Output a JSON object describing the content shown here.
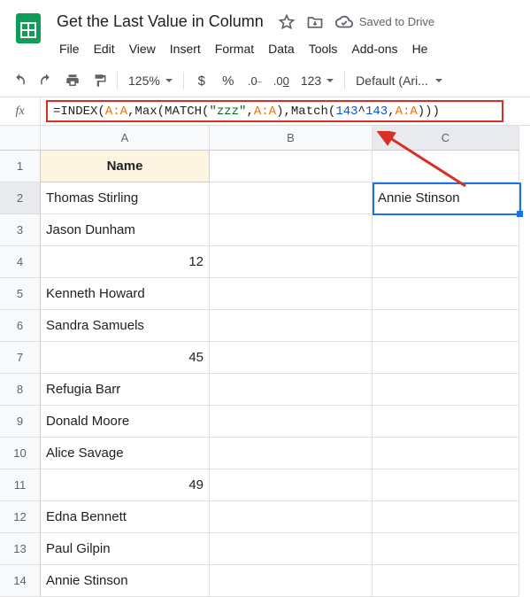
{
  "header": {
    "doc_title": "Get the Last Value in Column",
    "saved_label": "Saved to Drive",
    "menu": [
      "File",
      "Edit",
      "View",
      "Insert",
      "Format",
      "Data",
      "Tools",
      "Add-ons",
      "He"
    ]
  },
  "toolbar": {
    "zoom": "125%",
    "font": "Default (Ari..."
  },
  "formula": {
    "tokens": [
      {
        "t": "=INDEX(",
        "c": "f-black"
      },
      {
        "t": "A:A",
        "c": "f-orange"
      },
      {
        "t": ",Max(MATCH(",
        "c": "f-black"
      },
      {
        "t": "\"zzz\"",
        "c": "f-green"
      },
      {
        "t": ",",
        "c": "f-black"
      },
      {
        "t": "A:A",
        "c": "f-orange"
      },
      {
        "t": "),Match(",
        "c": "f-black"
      },
      {
        "t": "143",
        "c": "f-blue"
      },
      {
        "t": "^",
        "c": "f-black"
      },
      {
        "t": "143",
        "c": "f-blue"
      },
      {
        "t": ",",
        "c": "f-black"
      },
      {
        "t": "A:A",
        "c": "f-orange"
      },
      {
        "t": ")))",
        "c": "f-black"
      }
    ]
  },
  "grid": {
    "columns": [
      "A",
      "B",
      "C"
    ],
    "rows": [
      {
        "n": "1",
        "A": "Name",
        "A_header": true
      },
      {
        "n": "2",
        "A": "Thomas Stirling",
        "C": "Annie Stinson",
        "C_selected": true
      },
      {
        "n": "3",
        "A": "Jason Dunham"
      },
      {
        "n": "4",
        "A": "12",
        "A_numeric": true
      },
      {
        "n": "5",
        "A": "Kenneth Howard"
      },
      {
        "n": "6",
        "A": "Sandra Samuels"
      },
      {
        "n": "7",
        "A": "45",
        "A_numeric": true
      },
      {
        "n": "8",
        "A": "Refugia Barr"
      },
      {
        "n": "9",
        "A": "Donald Moore"
      },
      {
        "n": "10",
        "A": "Alice Savage"
      },
      {
        "n": "11",
        "A": "49",
        "A_numeric": true
      },
      {
        "n": "12",
        "A": "Edna Bennett"
      },
      {
        "n": "13",
        "A": "Paul Gilpin"
      },
      {
        "n": "14",
        "A": "Annie Stinson"
      }
    ]
  }
}
